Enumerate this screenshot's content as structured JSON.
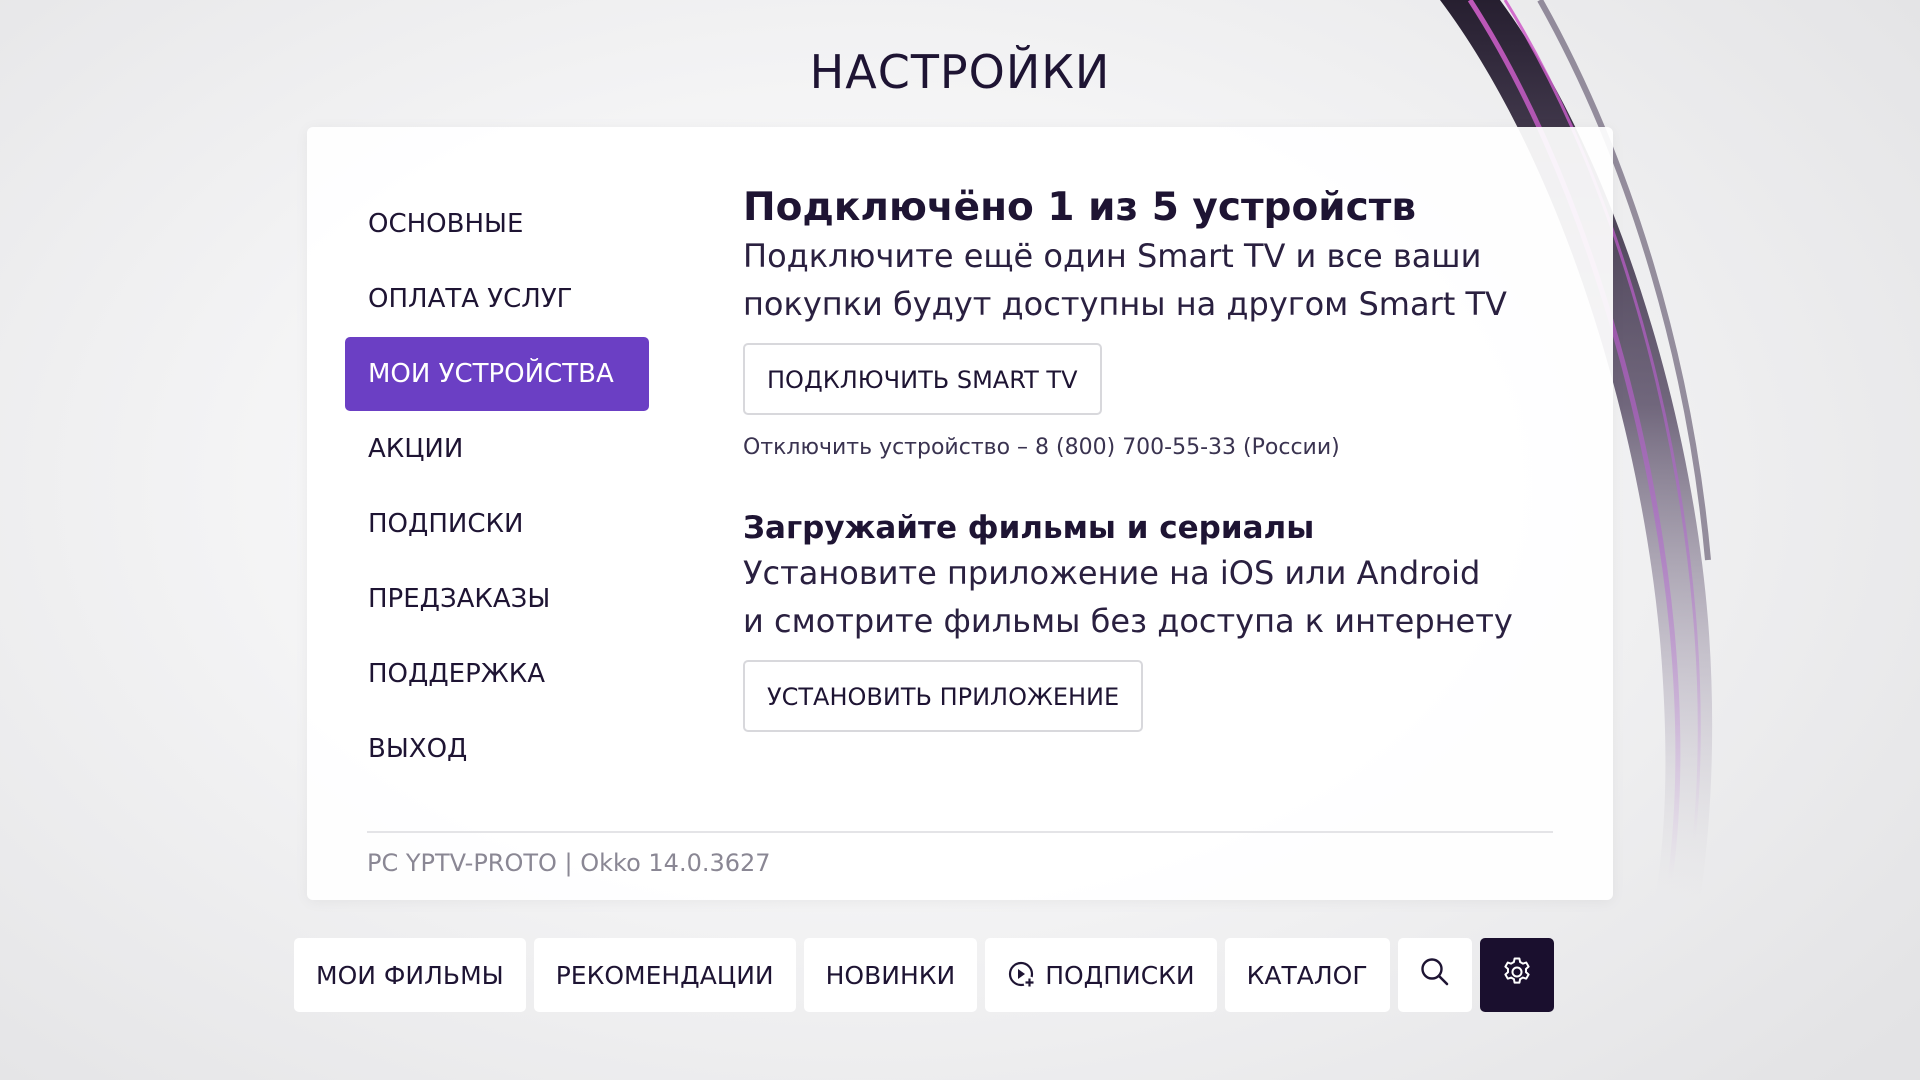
{
  "page": {
    "title": "НАСТРОЙКИ"
  },
  "menu": {
    "items": [
      {
        "label": "ОСНОВНЫЕ"
      },
      {
        "label": "ОПЛАТА УСЛУГ"
      },
      {
        "label": "МОИ УСТРОЙСТВА",
        "active": true
      },
      {
        "label": "АКЦИИ"
      },
      {
        "label": "ПОДПИСКИ"
      },
      {
        "label": "ПРЕДЗАКАЗЫ"
      },
      {
        "label": "ПОДДЕРЖКА"
      },
      {
        "label": "ВЫХОД"
      }
    ]
  },
  "devices": {
    "heading": "Подключёно 1 из 5 устройств",
    "desc_line1": "Подключите ещё один Smart TV и все ваши",
    "desc_line2": "покупки будут доступны на другом Smart TV",
    "button": "ПОДКЛЮЧИТЬ SMART TV",
    "note": "Отключить устройство – 8 (800) 700-55-33 (России)"
  },
  "apps": {
    "heading": "Загружайте фильмы и сериалы",
    "desc_line1": "Установите приложение на iOS или Android",
    "desc_line2": "и смотрите фильмы без доступа к интернету",
    "button": "УСТАНОВИТЬ ПРИЛОЖЕНИЕ"
  },
  "version": "PC YPTV-PROTO | Okko 14.0.3627",
  "bottom_nav": {
    "items": [
      {
        "label": "МОИ ФИЛЬМЫ"
      },
      {
        "label": "РЕКОМЕНДАЦИИ"
      },
      {
        "label": "НОВИНКИ"
      },
      {
        "label": "ПОДПИСКИ",
        "icon": "play-plus-icon"
      },
      {
        "label": "КАТАЛОГ"
      }
    ],
    "search_icon": "search-icon",
    "settings_icon": "gear-icon"
  },
  "colors": {
    "accent": "#6b3fc4",
    "text_dark": "#1e1433",
    "settings_bg": "#1a0f2e"
  }
}
